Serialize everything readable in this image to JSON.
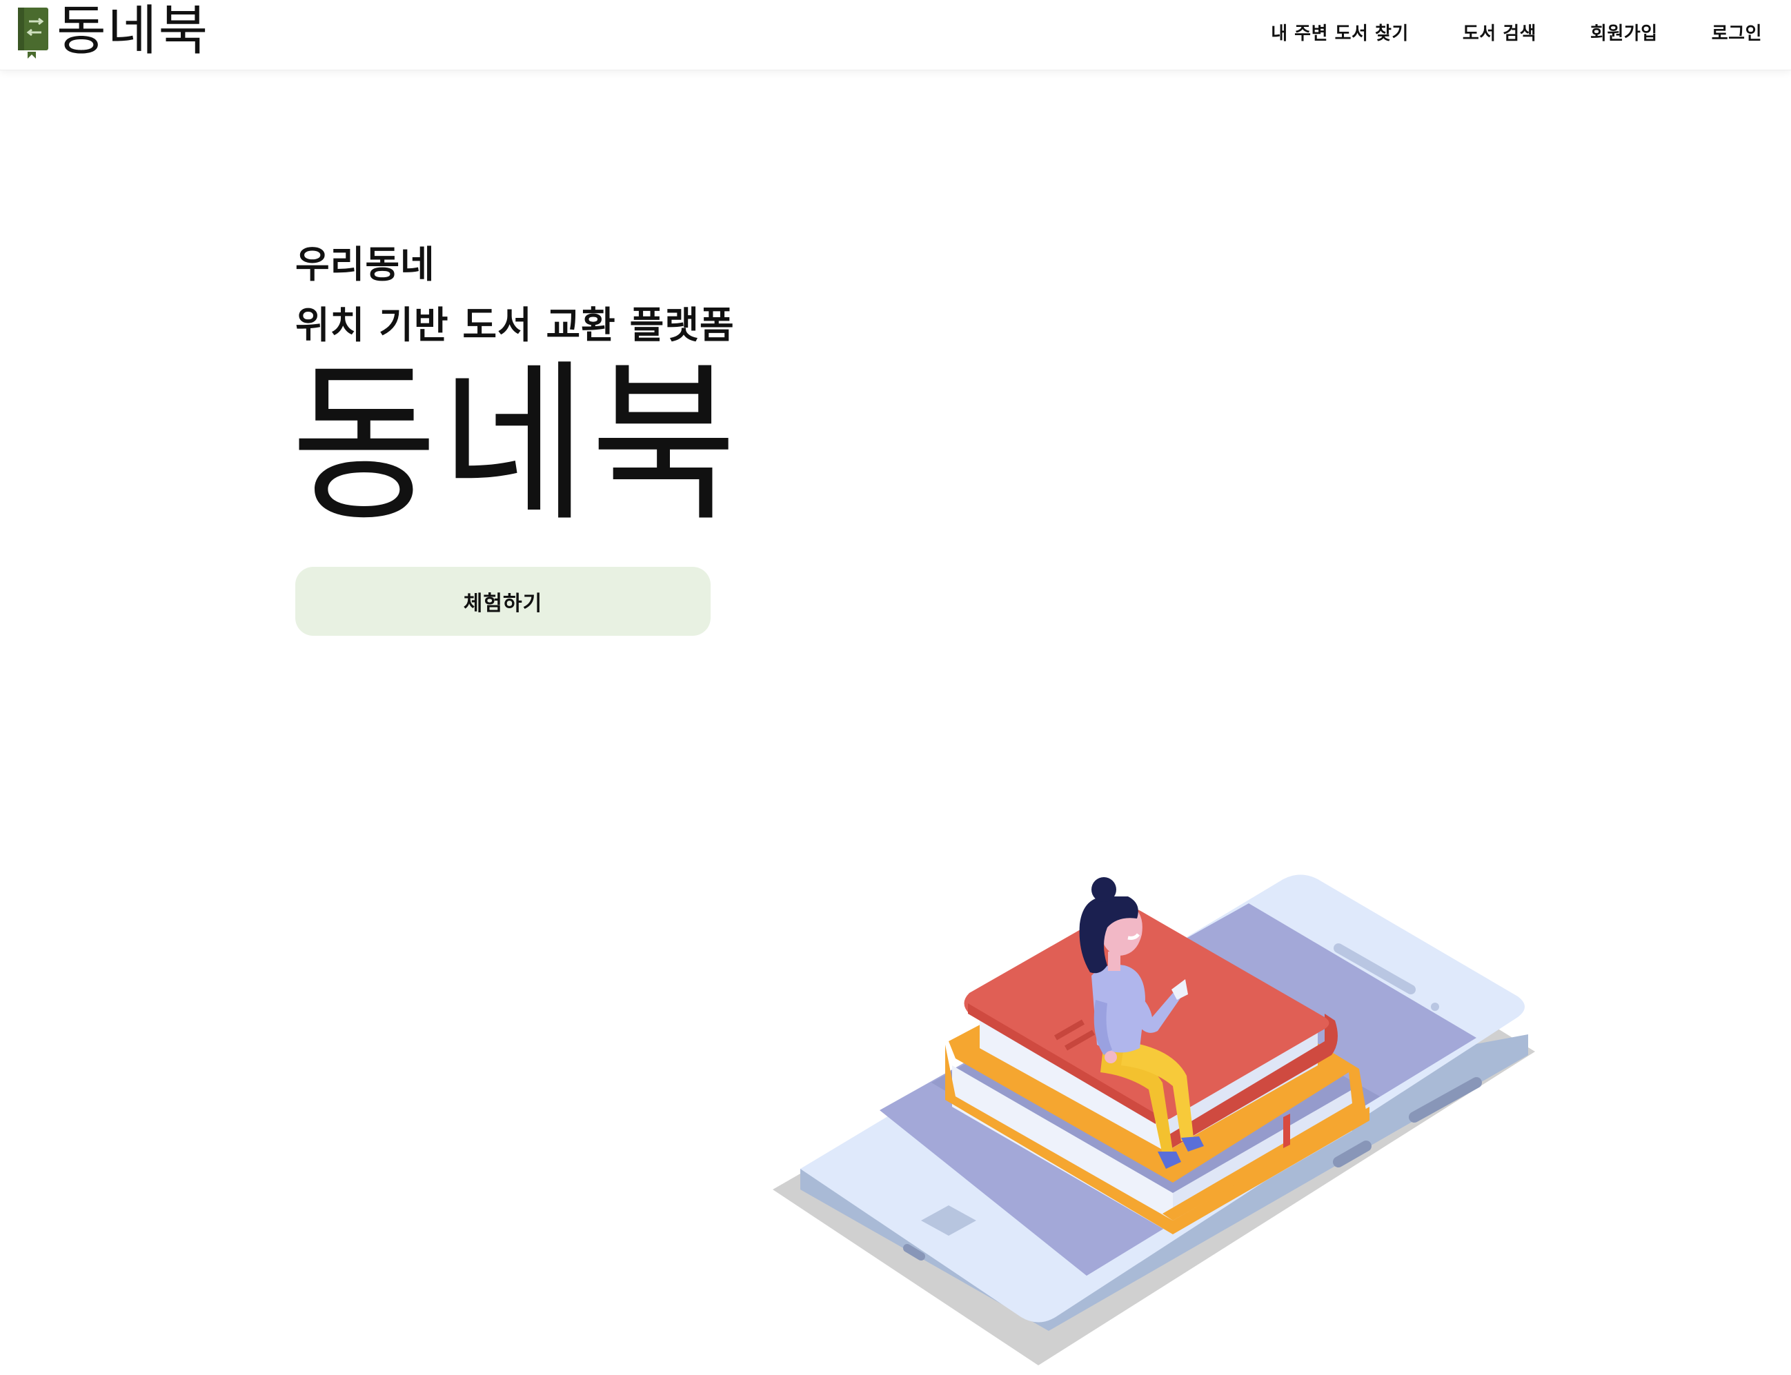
{
  "header": {
    "logo_text": "동네북",
    "nav": {
      "find_nearby": "내 주변 도서 찾기",
      "search_books": "도서 검색",
      "signup": "회원가입",
      "login": "로그인"
    }
  },
  "hero": {
    "subtitle_line1": "우리동네",
    "subtitle_line2": "위치 기반 도서 교환 플랫폼",
    "title": "동네북",
    "cta_label": "체험하기"
  },
  "colors": {
    "accent_green": "#4a6b2e",
    "cta_background": "#e8f1e2",
    "book_red": "#e05f55",
    "book_orange": "#f5a630",
    "phone_light": "#dfe9fb",
    "phone_screen": "#a3a8d8"
  }
}
